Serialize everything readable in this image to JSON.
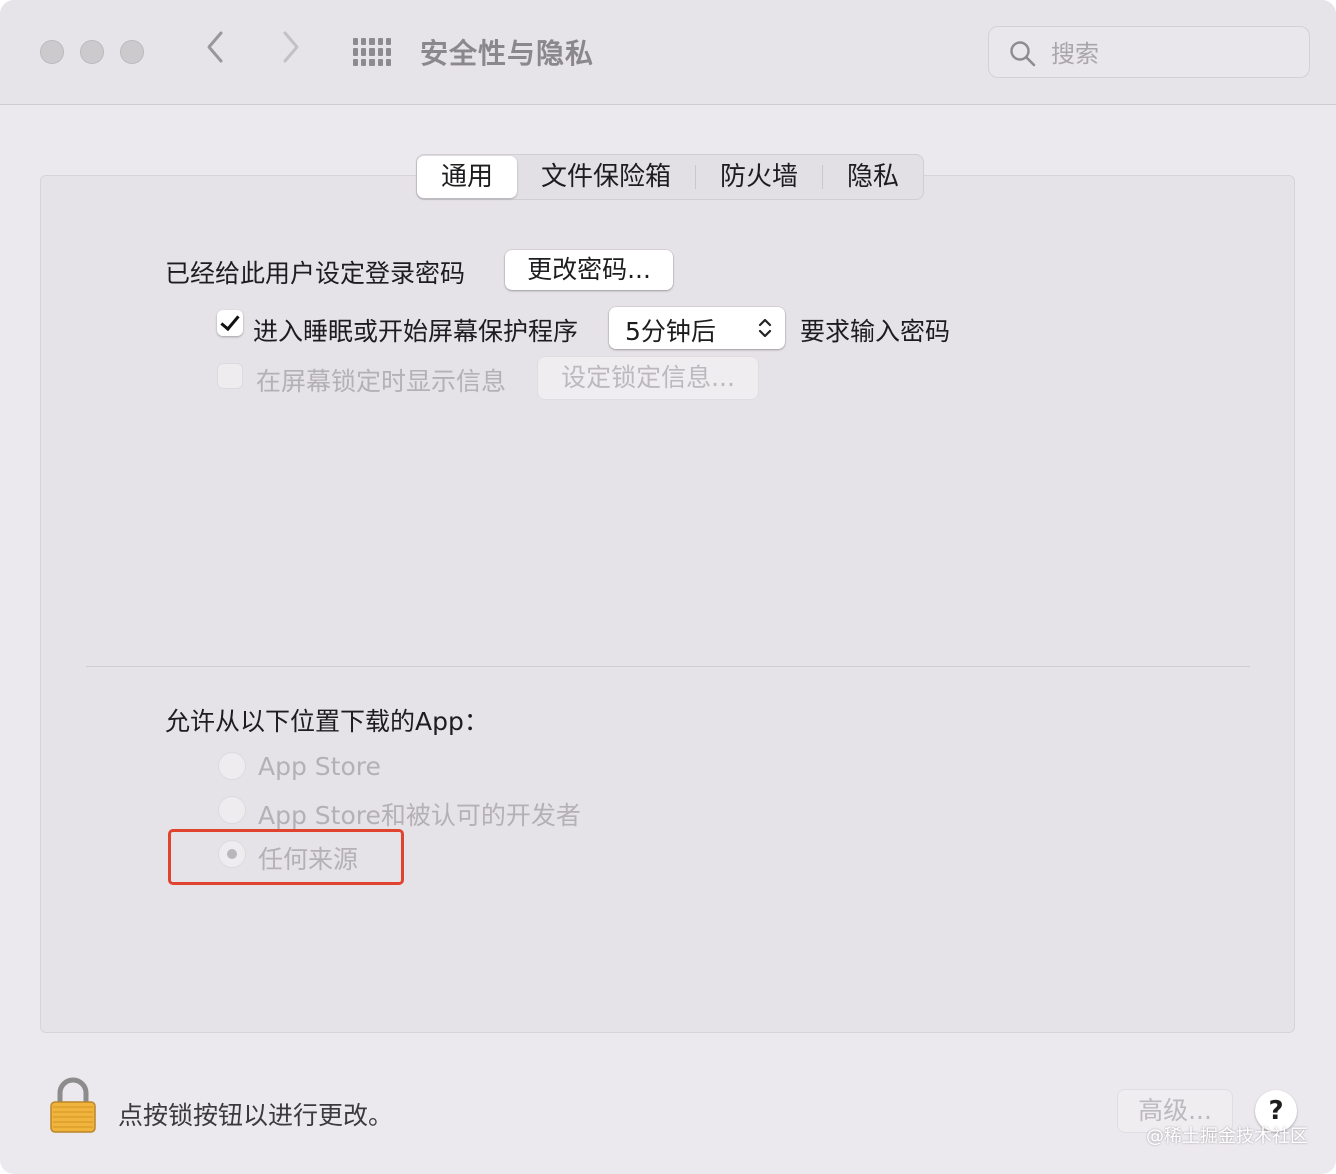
{
  "window": {
    "title": "安全性与隐私"
  },
  "search": {
    "placeholder": "搜索"
  },
  "tabs": [
    {
      "label": "通用",
      "active": true
    },
    {
      "label": "文件保险箱",
      "active": false
    },
    {
      "label": "防火墙",
      "active": false
    },
    {
      "label": "隐私",
      "active": false
    }
  ],
  "general": {
    "password_set_text": "已经给此用户设定登录密码",
    "change_password_button": "更改密码...",
    "require_password": {
      "checked": true,
      "label": "进入睡眠或开始屏幕保护程序",
      "delay_value": "5分钟后",
      "suffix": "要求输入密码"
    },
    "show_message": {
      "checked": false,
      "enabled": false,
      "label": "在屏幕锁定时显示信息",
      "button": "设定锁定信息..."
    }
  },
  "download": {
    "heading": "允许从以下位置下载的App：",
    "options": [
      {
        "label": "App Store",
        "selected": false
      },
      {
        "label": "App Store和被认可的开发者",
        "selected": false
      },
      {
        "label": "任何来源",
        "selected": true
      }
    ],
    "highlight_color": "#e0432e"
  },
  "footer": {
    "lock_text": "点按锁按钮以进行更改。",
    "advanced_button": "高级...",
    "help_button": "?"
  },
  "watermark": "@稀土掘金技术社区"
}
